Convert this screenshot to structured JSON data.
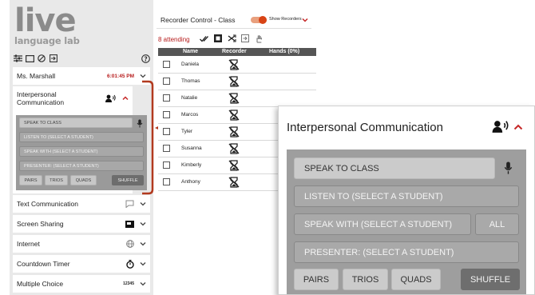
{
  "logo": {
    "word": "live",
    "sub": "language lab"
  },
  "sidebar": {
    "teacher": "Ms. Marshall",
    "time": "6:01:45 PM",
    "ic_label": "Interpersonal Communication",
    "panel": {
      "speak_to_class": "SPEAK TO CLASS",
      "listen_to": "LISTEN TO (SELECT A STUDENT)",
      "speak_with": "SPEAK WITH (SELECT A STUDENT)",
      "presenter": "PRESENTER: (SELECT A STUDENT)",
      "pairs": "PAIRS",
      "trios": "TRIOS",
      "quads": "QUADS",
      "shuffle": "SHUFFLE"
    },
    "items": [
      {
        "label": "Text Communication",
        "icon": "chat-icon"
      },
      {
        "label": "Screen Sharing",
        "icon": "screen-icon"
      },
      {
        "label": "Internet",
        "icon": "globe-icon"
      },
      {
        "label": "Countdown Timer",
        "icon": "timer-icon"
      },
      {
        "label": "Multiple Choice",
        "badge": "12345"
      }
    ]
  },
  "main": {
    "header": "Recorder Control - Class",
    "show_recorders": "Show Recorders",
    "attending": "8 attending",
    "columns": {
      "name": "Name",
      "recorder": "Recorder",
      "hands": "Hands (0%)"
    },
    "students": [
      "Daniela",
      "Thomas",
      "Natalie",
      "Marcos",
      "Tyler",
      "Susanna",
      "Kimberly",
      "Anthony"
    ]
  },
  "zoom": {
    "title": "Interpersonal Communication",
    "speak_to_class": "SPEAK TO CLASS",
    "listen_to": "LISTEN TO (SELECT A STUDENT)",
    "speak_with": "SPEAK WITH (SELECT A STUDENT)",
    "all": "ALL",
    "presenter": "PRESENTER: (SELECT A STUDENT)",
    "pairs": "PAIRS",
    "trios": "TRIOS",
    "quads": "QUADS",
    "shuffle": "SHUFFLE"
  },
  "colors": {
    "accent": "#d84315",
    "attending": "#b71c1c",
    "arrow": "#b23a1f"
  }
}
